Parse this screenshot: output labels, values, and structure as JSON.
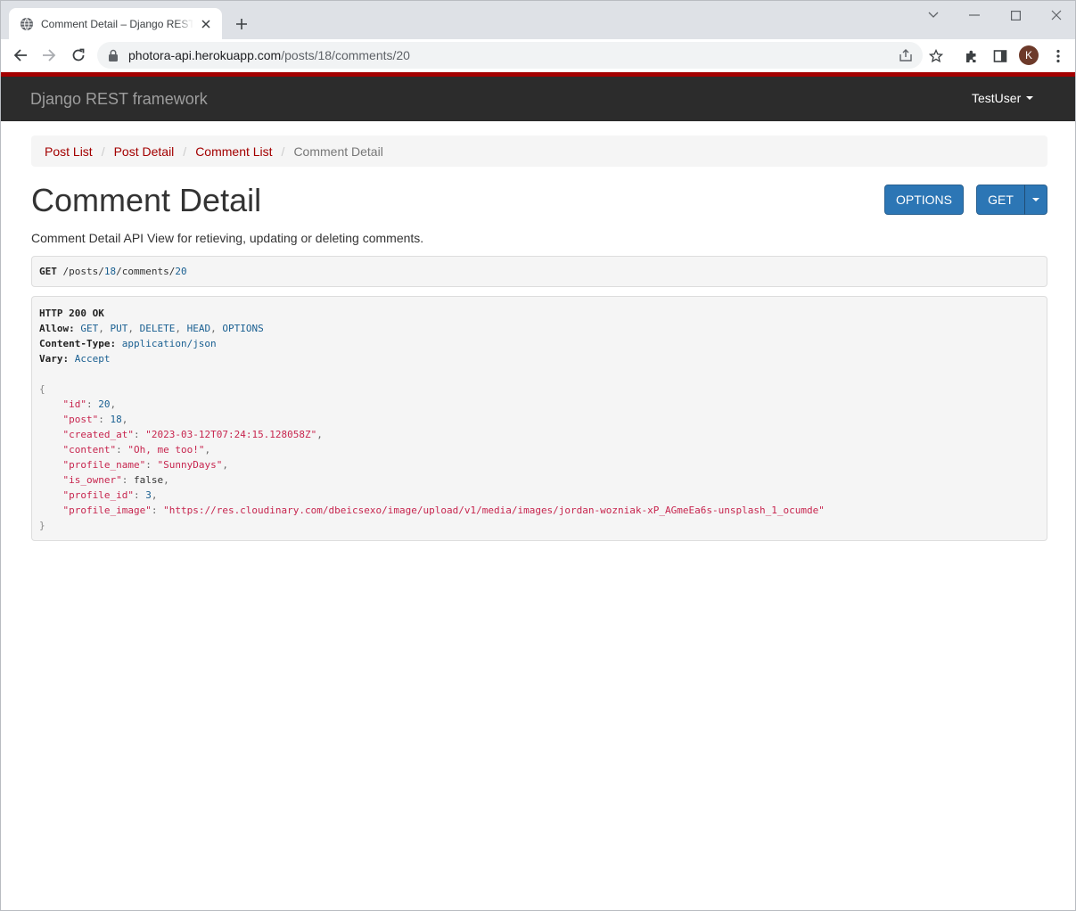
{
  "browser": {
    "tab_title": "Comment Detail – Django REST framework",
    "url_host": "photora-api.herokuapp.com",
    "url_path": "/posts/18/comments/20",
    "profile_initial": "K"
  },
  "navbar": {
    "brand": "Django REST framework",
    "user": "TestUser"
  },
  "breadcrumb": {
    "items": [
      "Post List",
      "Post Detail",
      "Comment List"
    ],
    "active": "Comment Detail",
    "separator": "/"
  },
  "page": {
    "title": "Comment Detail",
    "description": "Comment Detail API View for retieving, updating or deleting comments.",
    "options_button": "OPTIONS",
    "get_button": "GET"
  },
  "request": {
    "method": "GET",
    "path_parts": [
      "/posts/",
      "18",
      "/comments/",
      "20"
    ]
  },
  "response": {
    "status": "HTTP 200 OK",
    "allow_label": "Allow:",
    "allow": [
      "GET",
      "PUT",
      "DELETE",
      "HEAD",
      "OPTIONS"
    ],
    "content_type_label": "Content-Type:",
    "content_type": "application/json",
    "vary_label": "Vary:",
    "vary": "Accept",
    "open_brace": "{",
    "close_brace": "}",
    "fields": [
      {
        "key": "\"id\"",
        "value": "20",
        "kind": "lit"
      },
      {
        "key": "\"post\"",
        "value": "18",
        "kind": "lit"
      },
      {
        "key": "\"created_at\"",
        "value": "\"2023-03-12T07:24:15.128058Z\"",
        "kind": "str"
      },
      {
        "key": "\"content\"",
        "value": "\"Oh, me too!\"",
        "kind": "str"
      },
      {
        "key": "\"profile_name\"",
        "value": "\"SunnyDays\"",
        "kind": "str"
      },
      {
        "key": "\"is_owner\"",
        "value": "false",
        "kind": "plain"
      },
      {
        "key": "\"profile_id\"",
        "value": "3",
        "kind": "lit"
      },
      {
        "key": "\"profile_image\"",
        "value": "\"https://res.cloudinary.com/dbeicsexo/image/upload/v1/media/images/jordan-wozniak-xP_AGmeEa6s-unsplash_1_ocumde\"",
        "kind": "str"
      }
    ]
  },
  "colors": {
    "accent_red": "#a30000",
    "button_blue": "#2c76b5",
    "navbar_bg": "#2c2c2c"
  }
}
